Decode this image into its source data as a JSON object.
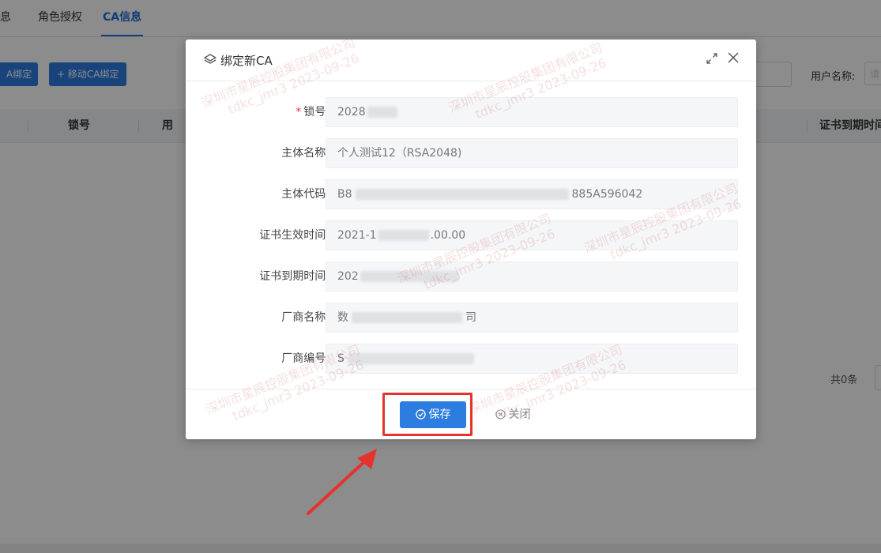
{
  "tabs": [
    {
      "label": "息",
      "active": false
    },
    {
      "label": "角色授权",
      "active": false
    },
    {
      "label": "CA信息",
      "active": true
    }
  ],
  "toolbar": {
    "bind_partial_label": "A绑定",
    "mobile_bind_label": "+ 移动CA绑定"
  },
  "search": {
    "user_name_label": "用户名称:",
    "user_name_placeholder": "请"
  },
  "table": {
    "columns": [
      "锁号",
      "用",
      "证书到期时间"
    ]
  },
  "pagination": {
    "total_label": "共0条"
  },
  "dialog": {
    "title": "绑定新CA",
    "fields": [
      {
        "label": "锁号:",
        "required": true,
        "value_visible": "2028"
      },
      {
        "label": "主体名称:",
        "required": false,
        "value_visible": "个人测试12（RSA2048)"
      },
      {
        "label": "主体代码:",
        "required": false,
        "value_visible": "B8",
        "value_visible_tail": "885A596042"
      },
      {
        "label": "证书生效时间:",
        "required": false,
        "value_visible": "2021-1",
        "value_visible_tail": ".00.00"
      },
      {
        "label": "证书到期时间:",
        "required": false,
        "value_visible": "202"
      },
      {
        "label": "厂商名称:",
        "required": false,
        "value_visible": "数",
        "value_visible_tail": "司"
      },
      {
        "label": "厂商编号:",
        "required": false,
        "value_visible": "S"
      }
    ],
    "save_label": "保存",
    "close_label": "关闭"
  },
  "watermark": {
    "line1": "深圳市星辰控股集团有限公司",
    "line2": "tdkc_jmr3 2023-09-26"
  },
  "colors": {
    "accent": "#2d7ce0",
    "highlight": "#e5322d",
    "required": "#e0383e"
  },
  "icons": [
    "layers-icon",
    "expand-icon",
    "close-icon",
    "check-circle-icon",
    "x-circle-icon",
    "plus-icon",
    "annotation-arrow"
  ]
}
